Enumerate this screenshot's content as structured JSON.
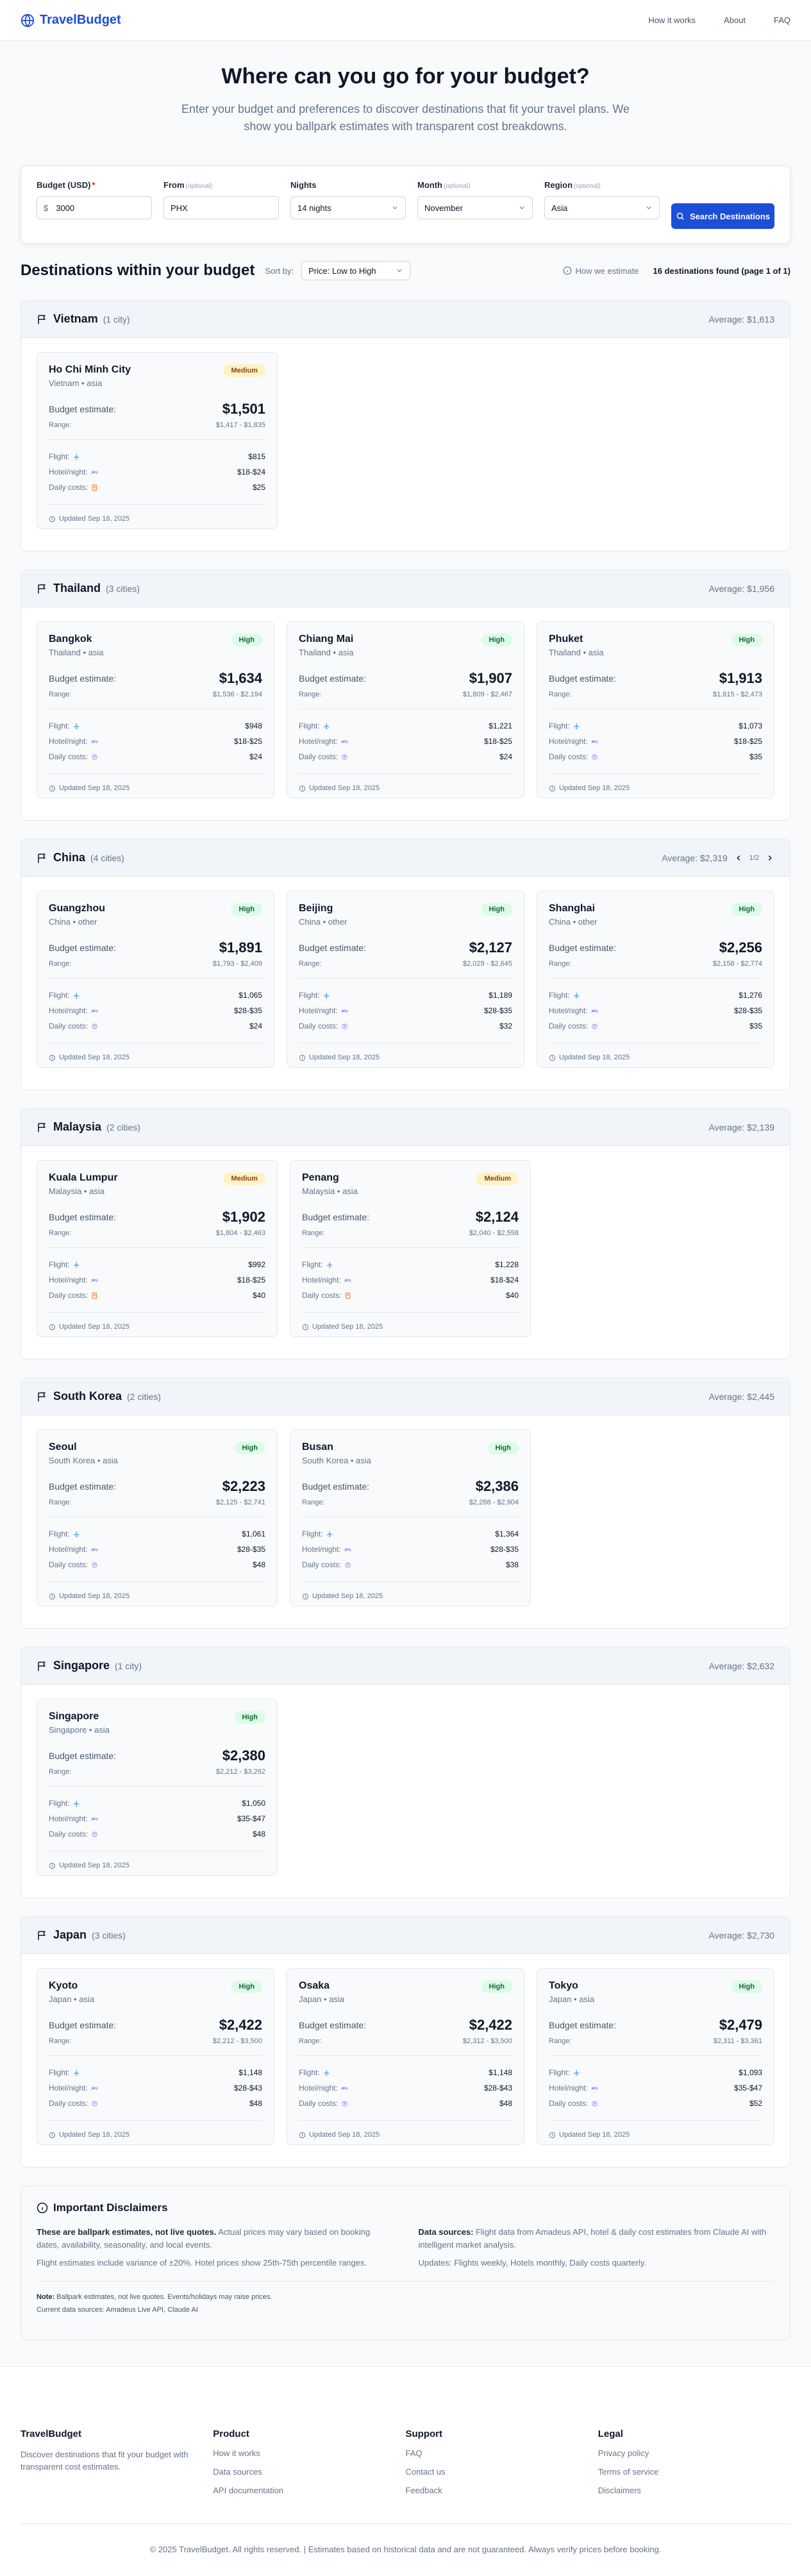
{
  "header": {
    "brand": "TravelBudget",
    "nav": [
      "How it works",
      "About",
      "FAQ"
    ]
  },
  "hero": {
    "title": "Where can you go for your budget?",
    "subtitle": "Enter your budget and preferences to discover destinations that fit your travel plans. We show you ballpark estimates with transparent cost breakdowns."
  },
  "search": {
    "budget_label": "Budget (USD)",
    "budget_required": "*",
    "budget_prefix": "$",
    "budget_value": "3000",
    "from_label": "From",
    "from_opt": "(optional)",
    "from_value": "PHX",
    "nights_label": "Nights",
    "nights_value": "14 nights",
    "month_label": "Month",
    "month_opt": "(optional)",
    "month_value": "November",
    "region_label": "Region",
    "region_opt": "(optional)",
    "region_value": "Asia",
    "button": "Search Destinations"
  },
  "results": {
    "title": "Destinations within your budget",
    "sort_label": "Sort by:",
    "sort_value": "Price: Low to High",
    "how_estimate": "How we estimate",
    "found": "16 destinations found (page 1 of 1)"
  },
  "countries": [
    {
      "name": "Vietnam",
      "count": "(1 city)",
      "average": "Average: $1,613",
      "cities": [
        {
          "name": "Ho Chi Minh City",
          "sub": "Vietnam • asia",
          "badge": "Medium",
          "level": "medium",
          "est_label": "Budget estimate:",
          "estimate": "$1,501",
          "range_label": "Range:",
          "range": "$1,417 - $1,835",
          "flight_label": "Flight:",
          "flight": "$815",
          "hotel_label": "Hotel/night:",
          "hotel": "$18-$24",
          "daily_label": "Daily costs:",
          "daily": "$25",
          "daily_icon": "orange",
          "updated": "Updated Sep 18, 2025"
        }
      ]
    },
    {
      "name": "Thailand",
      "count": "(3 cities)",
      "average": "Average: $1,956",
      "cities": [
        {
          "name": "Bangkok",
          "sub": "Thailand • asia",
          "badge": "High",
          "level": "high",
          "est_label": "Budget estimate:",
          "estimate": "$1,634",
          "range_label": "Range:",
          "range": "$1,536 - $2,194",
          "flight_label": "Flight:",
          "flight": "$948",
          "hotel_label": "Hotel/night:",
          "hotel": "$18-$25",
          "daily_label": "Daily costs:",
          "daily": "$24",
          "daily_icon": "purple",
          "updated": "Updated Sep 18, 2025"
        },
        {
          "name": "Chiang Mai",
          "sub": "Thailand • asia",
          "badge": "High",
          "level": "high",
          "est_label": "Budget estimate:",
          "estimate": "$1,907",
          "range_label": "Range:",
          "range": "$1,809 - $2,467",
          "flight_label": "Flight:",
          "flight": "$1,221",
          "hotel_label": "Hotel/night:",
          "hotel": "$18-$25",
          "daily_label": "Daily costs:",
          "daily": "$24",
          "daily_icon": "purple",
          "updated": "Updated Sep 18, 2025"
        },
        {
          "name": "Phuket",
          "sub": "Thailand • asia",
          "badge": "High",
          "level": "high",
          "est_label": "Budget estimate:",
          "estimate": "$1,913",
          "range_label": "Range:",
          "range": "$1,815 - $2,473",
          "flight_label": "Flight:",
          "flight": "$1,073",
          "hotel_label": "Hotel/night:",
          "hotel": "$18-$25",
          "daily_label": "Daily costs:",
          "daily": "$35",
          "daily_icon": "purple",
          "updated": "Updated Sep 18, 2025"
        }
      ]
    },
    {
      "name": "China",
      "count": "(4 cities)",
      "average": "Average: $2,319",
      "pager": "1/2",
      "cities": [
        {
          "name": "Guangzhou",
          "sub": "China • other",
          "badge": "High",
          "level": "high",
          "est_label": "Budget estimate:",
          "estimate": "$1,891",
          "range_label": "Range:",
          "range": "$1,793 - $2,409",
          "flight_label": "Flight:",
          "flight": "$1,065",
          "hotel_label": "Hotel/night:",
          "hotel": "$28-$35",
          "daily_label": "Daily costs:",
          "daily": "$24",
          "daily_icon": "purple",
          "updated": "Updated Sep 18, 2025"
        },
        {
          "name": "Beijing",
          "sub": "China • other",
          "badge": "High",
          "level": "high",
          "est_label": "Budget estimate:",
          "estimate": "$2,127",
          "range_label": "Range:",
          "range": "$2,029 - $2,645",
          "flight_label": "Flight:",
          "flight": "$1,189",
          "hotel_label": "Hotel/night:",
          "hotel": "$28-$35",
          "daily_label": "Daily costs:",
          "daily": "$32",
          "daily_icon": "purple",
          "updated": "Updated Sep 18, 2025"
        },
        {
          "name": "Shanghai",
          "sub": "China • other",
          "badge": "High",
          "level": "high",
          "est_label": "Budget estimate:",
          "estimate": "$2,256",
          "range_label": "Range:",
          "range": "$2,158 - $2,774",
          "flight_label": "Flight:",
          "flight": "$1,276",
          "hotel_label": "Hotel/night:",
          "hotel": "$28-$35",
          "daily_label": "Daily costs:",
          "daily": "$35",
          "daily_icon": "purple",
          "updated": "Updated Sep 18, 2025"
        }
      ]
    },
    {
      "name": "Malaysia",
      "count": "(2 cities)",
      "average": "Average: $2,139",
      "cities": [
        {
          "name": "Kuala Lumpur",
          "sub": "Malaysia • asia",
          "badge": "Medium",
          "level": "medium",
          "est_label": "Budget estimate:",
          "estimate": "$1,902",
          "range_label": "Range:",
          "range": "$1,804 - $2,463",
          "flight_label": "Flight:",
          "flight": "$992",
          "hotel_label": "Hotel/night:",
          "hotel": "$18-$25",
          "daily_label": "Daily costs:",
          "daily": "$40",
          "daily_icon": "orange",
          "updated": "Updated Sep 18, 2025"
        },
        {
          "name": "Penang",
          "sub": "Malaysia • asia",
          "badge": "Medium",
          "level": "medium",
          "est_label": "Budget estimate:",
          "estimate": "$2,124",
          "range_label": "Range:",
          "range": "$2,040 - $2,558",
          "flight_label": "Flight:",
          "flight": "$1,228",
          "hotel_label": "Hotel/night:",
          "hotel": "$18-$24",
          "daily_label": "Daily costs:",
          "daily": "$40",
          "daily_icon": "orange",
          "updated": "Updated Sep 18, 2025"
        }
      ]
    },
    {
      "name": "South Korea",
      "count": "(2 cities)",
      "average": "Average: $2,445",
      "cities": [
        {
          "name": "Seoul",
          "sub": "South Korea • asia",
          "badge": "High",
          "level": "high",
          "est_label": "Budget estimate:",
          "estimate": "$2,223",
          "range_label": "Range:",
          "range": "$2,125 - $2,741",
          "flight_label": "Flight:",
          "flight": "$1,061",
          "hotel_label": "Hotel/night:",
          "hotel": "$28-$35",
          "daily_label": "Daily costs:",
          "daily": "$48",
          "daily_icon": "purple",
          "updated": "Updated Sep 18, 2025"
        },
        {
          "name": "Busan",
          "sub": "South Korea • asia",
          "badge": "High",
          "level": "high",
          "est_label": "Budget estimate:",
          "estimate": "$2,386",
          "range_label": "Range:",
          "range": "$2,288 - $2,904",
          "flight_label": "Flight:",
          "flight": "$1,364",
          "hotel_label": "Hotel/night:",
          "hotel": "$28-$35",
          "daily_label": "Daily costs:",
          "daily": "$38",
          "daily_icon": "purple",
          "updated": "Updated Sep 18, 2025"
        }
      ]
    },
    {
      "name": "Singapore",
      "count": "(1 city)",
      "average": "Average: $2,632",
      "cities": [
        {
          "name": "Singapore",
          "sub": "Singapore • asia",
          "badge": "High",
          "level": "high",
          "est_label": "Budget estimate:",
          "estimate": "$2,380",
          "range_label": "Range:",
          "range": "$2,212 - $3,262",
          "flight_label": "Flight:",
          "flight": "$1,050",
          "hotel_label": "Hotel/night:",
          "hotel": "$35-$47",
          "daily_label": "Daily costs:",
          "daily": "$48",
          "daily_icon": "purple",
          "updated": "Updated Sep 18, 2025"
        }
      ]
    },
    {
      "name": "Japan",
      "count": "(3 cities)",
      "average": "Average: $2,730",
      "cities": [
        {
          "name": "Kyoto",
          "sub": "Japan • asia",
          "badge": "High",
          "level": "high",
          "est_label": "Budget estimate:",
          "estimate": "$2,422",
          "range_label": "Range:",
          "range": "$2,212 - $3,500",
          "flight_label": "Flight:",
          "flight": "$1,148",
          "hotel_label": "Hotel/night:",
          "hotel": "$28-$43",
          "daily_label": "Daily costs:",
          "daily": "$48",
          "daily_icon": "purple",
          "updated": "Updated Sep 18, 2025"
        },
        {
          "name": "Osaka",
          "sub": "Japan • asia",
          "badge": "High",
          "level": "high",
          "est_label": "Budget estimate:",
          "estimate": "$2,422",
          "range_label": "Range:",
          "range": "$2,312 - $3,500",
          "flight_label": "Flight:",
          "flight": "$1,148",
          "hotel_label": "Hotel/night:",
          "hotel": "$28-$43",
          "daily_label": "Daily costs:",
          "daily": "$48",
          "daily_icon": "purple",
          "updated": "Updated Sep 18, 2025"
        },
        {
          "name": "Tokyo",
          "sub": "Japan • asia",
          "badge": "High",
          "level": "high",
          "est_label": "Budget estimate:",
          "estimate": "$2,479",
          "range_label": "Range:",
          "range": "$2,311 - $3,361",
          "flight_label": "Flight:",
          "flight": "$1,093",
          "hotel_label": "Hotel/night:",
          "hotel": "$35-$47",
          "daily_label": "Daily costs:",
          "daily": "$52",
          "daily_icon": "purple",
          "updated": "Updated Sep 18, 2025"
        }
      ]
    }
  ],
  "disclaimer": {
    "title": "Important Disclaimers",
    "left_bold": "These are ballpark estimates, not live quotes.",
    "left_text": " Actual prices may vary based on booking dates, availability, seasonality, and local events.",
    "left_p2": "Flight estimates include variance of ±20%. Hotel prices show 25th-75th percentile ranges.",
    "right_bold": "Data sources:",
    "right_text": " Flight data from Amadeus API, hotel & daily cost estimates from Claude AI with intelligent market analysis.",
    "right_p2": "Updates: Flights weekly, Hotels monthly, Daily costs quarterly.",
    "note_bold": "Note:",
    "note_text": " Ballpark estimates, not live quotes. Events/holidays may raise prices.",
    "sources": "Current data sources: Amadeus Live API, Claude AI"
  },
  "footer": {
    "brand": "TravelBudget",
    "desc": "Discover destinations that fit your budget with transparent cost estimates.",
    "product_title": "Product",
    "product_links": [
      "How it works",
      "Data sources",
      "API documentation"
    ],
    "support_title": "Support",
    "support_links": [
      "FAQ",
      "Contact us",
      "Feedback"
    ],
    "legal_title": "Legal",
    "legal_links": [
      "Privacy policy",
      "Terms of service",
      "Disclaimers"
    ],
    "copyright": "© 2025 TravelBudget. All rights reserved. | Estimates based on historical data and are not guaranteed. Always verify prices before booking."
  },
  "colors": {
    "accent": "#1d4ed8",
    "high_badge_bg": "#dcfce7",
    "medium_badge_bg": "#fef3c7"
  }
}
